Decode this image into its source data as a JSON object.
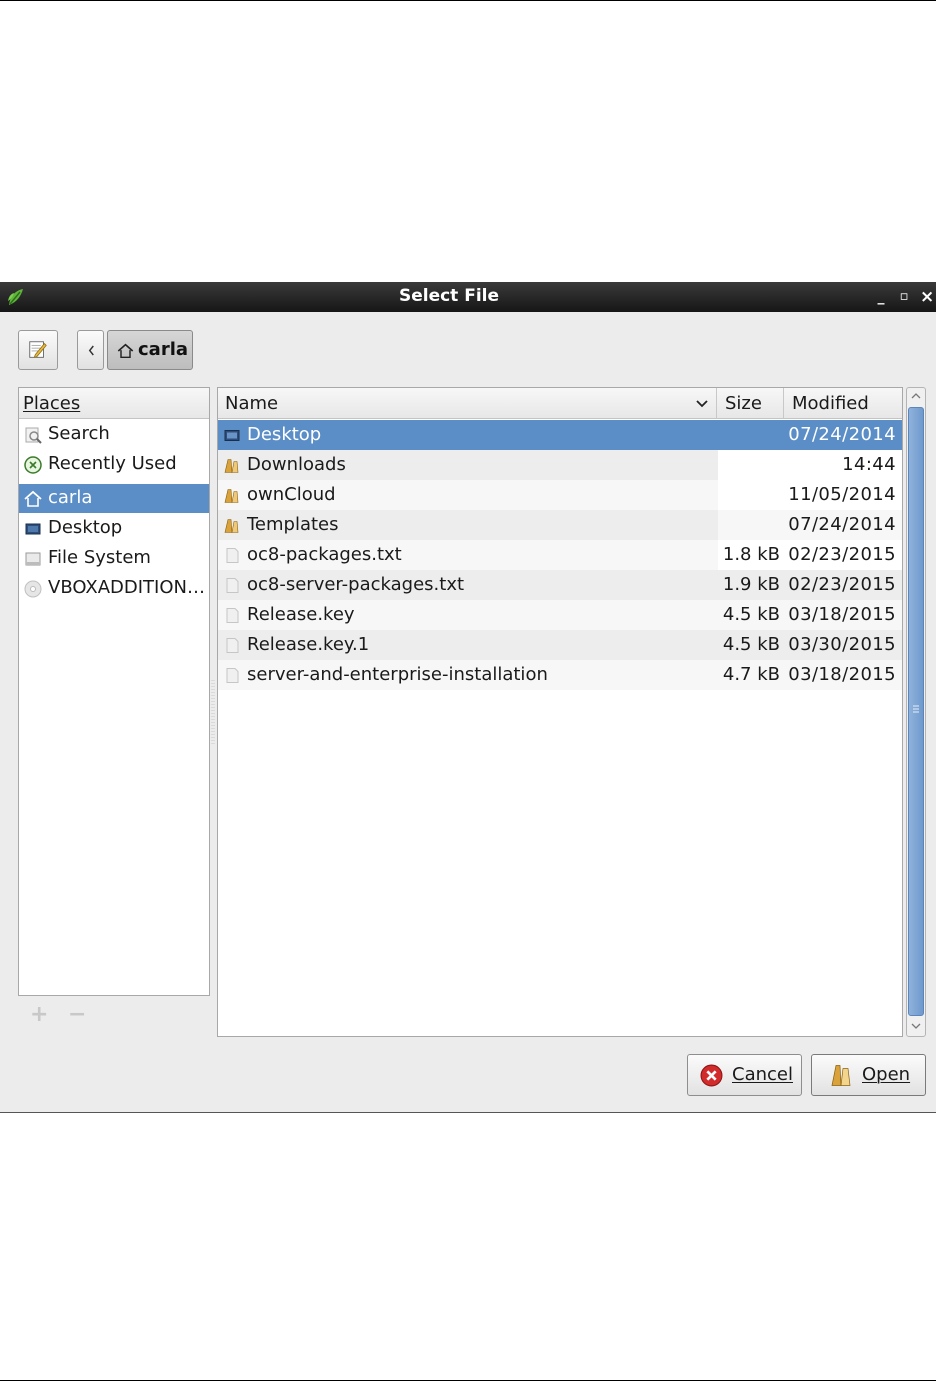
{
  "window": {
    "title": "Select File",
    "controls": {
      "minimize": "_",
      "maximize": "▫",
      "close": "×"
    }
  },
  "toolbar": {
    "breadcrumb_home_label": "carla"
  },
  "places": {
    "header": "Places",
    "items": [
      {
        "label": "Search",
        "icon": "search-icon"
      },
      {
        "label": "Recently Used",
        "icon": "recent-icon"
      },
      {
        "label": "carla",
        "icon": "home-icon",
        "selected": true
      },
      {
        "label": "Desktop",
        "icon": "desktop-icon"
      },
      {
        "label": "File System",
        "icon": "drive-icon"
      },
      {
        "label": "VBOXADDITION…",
        "icon": "disc-icon"
      }
    ]
  },
  "files": {
    "columns": {
      "name": "Name",
      "size": "Size",
      "modified": "Modified"
    },
    "rows": [
      {
        "name": "Desktop",
        "size": "",
        "modified": "07/24/2014",
        "icon": "desktop-icon",
        "selected": true
      },
      {
        "name": "Downloads",
        "size": "",
        "modified": "14:44",
        "icon": "folder-icon"
      },
      {
        "name": "ownCloud",
        "size": "",
        "modified": "11/05/2014",
        "icon": "folder-icon"
      },
      {
        "name": "Templates",
        "size": "",
        "modified": "07/24/2014",
        "icon": "folder-icon"
      },
      {
        "name": "oc8-packages.txt",
        "size": "1.8 kB",
        "modified": "02/23/2015",
        "icon": "file-icon"
      },
      {
        "name": "oc8-server-packages.txt",
        "size": "1.9 kB",
        "modified": "02/23/2015",
        "icon": "file-icon"
      },
      {
        "name": "Release.key",
        "size": "4.5 kB",
        "modified": "03/18/2015",
        "icon": "file-icon"
      },
      {
        "name": "Release.key.1",
        "size": "4.5 kB",
        "modified": "03/30/2015",
        "icon": "file-icon"
      },
      {
        "name": "server-and-enterprise-installation",
        "size": "4.7 kB",
        "modified": "03/18/2015",
        "icon": "file-icon"
      }
    ]
  },
  "buttons": {
    "cancel": "Cancel",
    "open": "Open"
  },
  "colors": {
    "selection": "#5b8ec6",
    "titlebar": "#1f1f1f"
  }
}
